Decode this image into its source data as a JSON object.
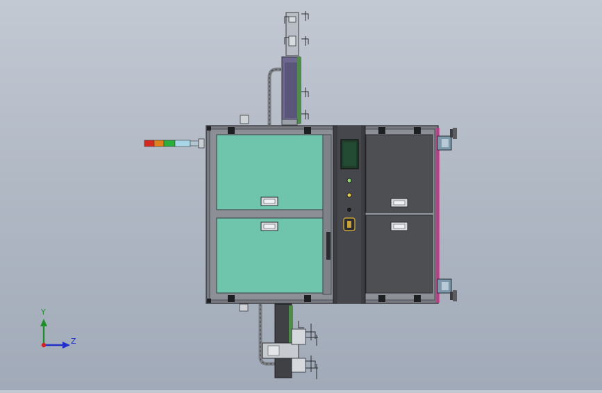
{
  "viewport": {
    "background_top": "#c3c9d3",
    "background_bottom": "#a1aab8"
  },
  "triad": {
    "y_label": "Y",
    "z_label": "Z",
    "y_color": "#1f8f2a",
    "z_color": "#2230c8",
    "origin_color": "#d42020"
  },
  "model": {
    "frame_color": "#5c5e62",
    "left_panel_color": "#6fc5ab",
    "right_panel_color": "#4d4f53",
    "control_strip_color": "#3b3d41",
    "screen_color": "#1f3b2a",
    "accent_color": "#c23f8b",
    "signal_tower_colors": [
      "#d42a1f",
      "#e0801e",
      "#2cae3c",
      "#a9d6e6",
      "#b4c6d1"
    ]
  }
}
